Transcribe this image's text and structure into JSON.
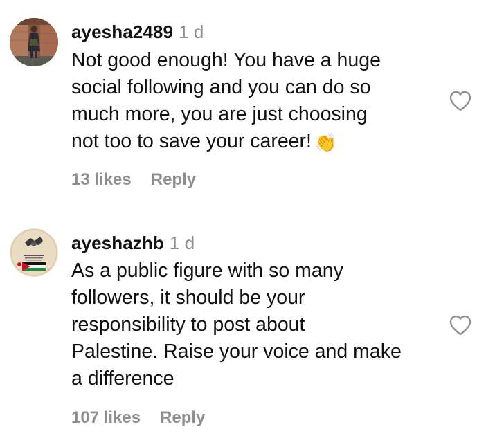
{
  "comments": [
    {
      "username": "ayesha2489",
      "timestamp": "1 d",
      "lines": [
        "Not good enough! You have a huge",
        "social following and you can do so",
        "much more, you are just choosing",
        "not too to save your career!"
      ],
      "emoji": "👏",
      "likes_label": "13 likes",
      "reply_label": "Reply",
      "avatar_icon": "user-photo-avatar",
      "like_icon": "heart-outline-icon"
    },
    {
      "username": "ayeshazhb",
      "timestamp": "1 d",
      "lines": [
        "As a public figure with so many",
        "followers, it should be your",
        "responsibility to post about",
        "Palestine. Raise your voice and make",
        "a difference"
      ],
      "likes_label": "107 likes",
      "reply_label": "Reply",
      "avatar_icon": "palestine-badge-avatar",
      "like_icon": "heart-outline-icon"
    }
  ],
  "colors": {
    "text": "#111111",
    "muted": "#8e8e8e",
    "background": "#ffffff"
  }
}
